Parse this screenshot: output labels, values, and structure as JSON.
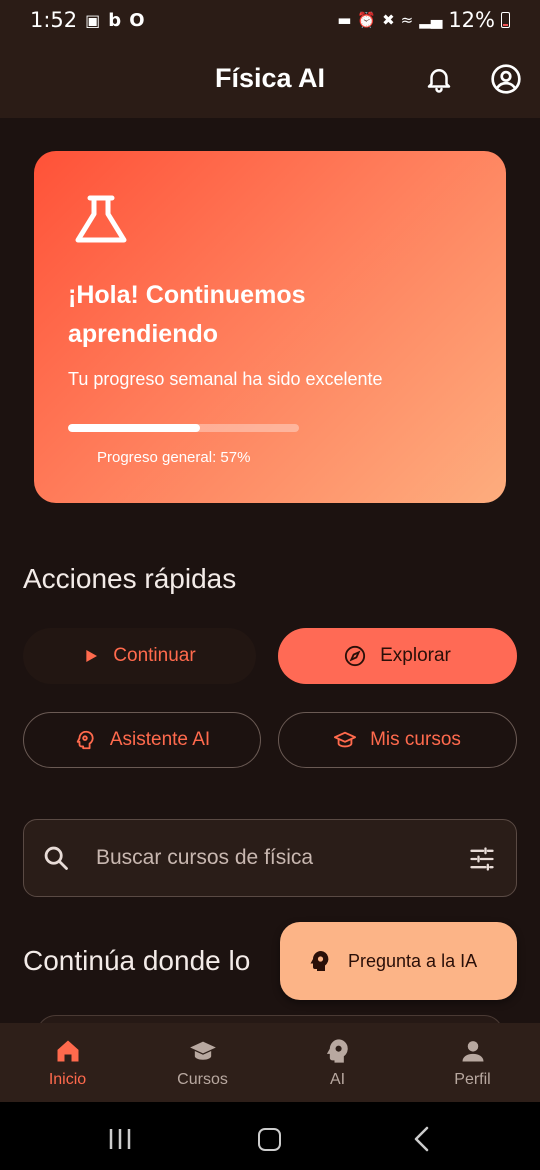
{
  "status_bar": {
    "time": "1:52",
    "notification_icons": [
      "image-icon",
      "b-icon",
      "o-icon"
    ],
    "system_icons": [
      "bed-icon",
      "alarm-icon",
      "mute-icon",
      "wifi-icon",
      "signal-icon"
    ],
    "battery_level": "12%"
  },
  "app_bar": {
    "title": "Física AI",
    "actions": [
      "bell-icon",
      "account-circle-icon"
    ]
  },
  "hero": {
    "icon": "flask-icon",
    "title": "¡Hola! Continuemos aprendiendo",
    "subtitle": "Tu progreso semanal ha sido excelente",
    "progress_fraction": 0.57,
    "progress_label": "Progreso general: 57%",
    "gradient": [
      "#ff5238",
      "#fdad7e"
    ]
  },
  "quick_actions": {
    "title": "Acciones rápidas",
    "continue_label": "Continuar",
    "explore_label": "Explorar",
    "assistant_label": "Asistente AI",
    "courses_label": "Mis cursos"
  },
  "search": {
    "placeholder": "Buscar cursos de física",
    "value": ""
  },
  "continue_section": {
    "title": "Continúa donde lo"
  },
  "fab": {
    "label": "Pregunta a la IA",
    "icon": "psychology-icon"
  },
  "bottom_nav": {
    "items": [
      {
        "label": "Inicio",
        "icon": "home-icon",
        "active": true
      },
      {
        "label": "Cursos",
        "icon": "school-icon",
        "active": false
      },
      {
        "label": "AI",
        "icon": "psychology-icon",
        "active": false
      },
      {
        "label": "Perfil",
        "icon": "person-icon",
        "active": false
      }
    ]
  },
  "colors": {
    "background": "#1c1210",
    "surface": "#2b1c16",
    "accent": "#ff6a4d",
    "fab": "#fcb487",
    "text": "#f3ebe8"
  }
}
